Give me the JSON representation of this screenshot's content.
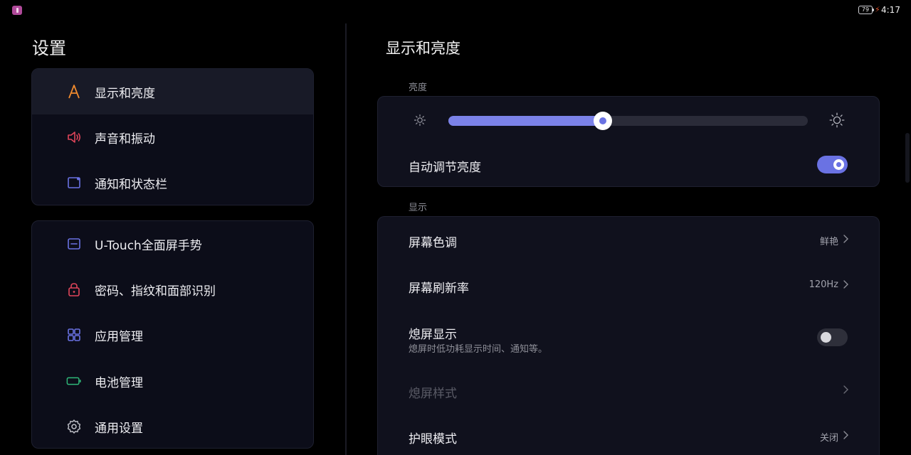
{
  "status_bar": {
    "battery": "79",
    "time": "4:17"
  },
  "sidebar": {
    "title": "设置",
    "group1": [
      {
        "label": "显示和亮度",
        "icon": "display-a-icon",
        "color": "#f08a2e"
      },
      {
        "label": "声音和振动",
        "icon": "speaker-icon",
        "color": "#e0455a"
      },
      {
        "label": "通知和状态栏",
        "icon": "notification-icon",
        "color": "#6a72e3"
      }
    ],
    "group2": [
      {
        "label": "U-Touch全面屏手势",
        "icon": "gesture-icon",
        "color": "#6a72e3"
      },
      {
        "label": "密码、指纹和面部识别",
        "icon": "lock-icon",
        "color": "#e0455a"
      },
      {
        "label": "应用管理",
        "icon": "apps-grid-icon",
        "color": "#6a72e3"
      },
      {
        "label": "电池管理",
        "icon": "battery-icon",
        "color": "#2fb879"
      },
      {
        "label": "通用设置",
        "icon": "gear-icon",
        "color": "#b9bac2"
      }
    ]
  },
  "main": {
    "title": "显示和亮度",
    "brightness_section": {
      "label": "亮度",
      "slider_value_fraction": 0.43,
      "auto_brightness_label": "自动调节亮度",
      "auto_brightness_on": true
    },
    "display_section": {
      "label": "显示",
      "rows": [
        {
          "label": "屏幕色调",
          "value": "鲜艳"
        },
        {
          "label": "屏幕刷新率",
          "value": "120Hz"
        },
        {
          "label": "熄屏显示",
          "sub": "熄屏时低功耗显示时间、通知等。",
          "toggle_on": false
        },
        {
          "label": "熄屏样式",
          "disabled": true
        },
        {
          "label": "护眼模式",
          "value": "关闭"
        }
      ]
    }
  },
  "colors": {
    "accent": "#6a72e3",
    "background": "#000000",
    "card": "#0c0d19"
  }
}
